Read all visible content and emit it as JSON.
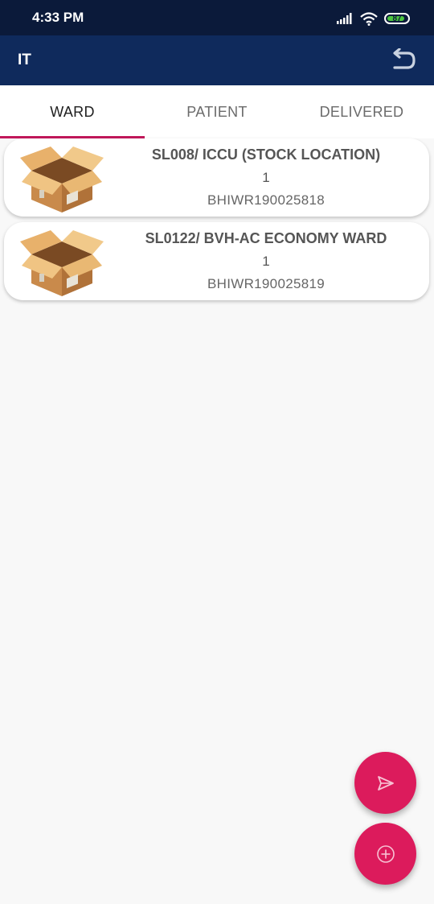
{
  "status_bar": {
    "time": "4:33 PM",
    "battery": "87",
    "icons": [
      "signal-icon",
      "wifi-icon",
      "battery-icon"
    ]
  },
  "app_bar": {
    "title": "IT",
    "back_icon": "undo-arrow-icon"
  },
  "tabs": [
    {
      "label": "WARD",
      "active": true
    },
    {
      "label": "PATIENT",
      "active": false
    },
    {
      "label": "DELIVERED",
      "active": false
    }
  ],
  "items": [
    {
      "title": "SL008/ ICCU (STOCK LOCATION)",
      "quantity": "1",
      "code": "BHIWR190025818",
      "icon": "open-box-icon"
    },
    {
      "title": "SL0122/ BVH-AC ECONOMY WARD",
      "quantity": "1",
      "code": "BHIWR190025819",
      "icon": "open-box-icon"
    }
  ],
  "fabs": {
    "send_icon": "send-icon",
    "add_icon": "add-circle-icon"
  },
  "colors": {
    "status_bar": "#0b1a3a",
    "app_bar": "#0f2a5c",
    "accent": "#dc1b5c",
    "tab_indicator": "#c2185b",
    "background": "#f8f8f8"
  }
}
